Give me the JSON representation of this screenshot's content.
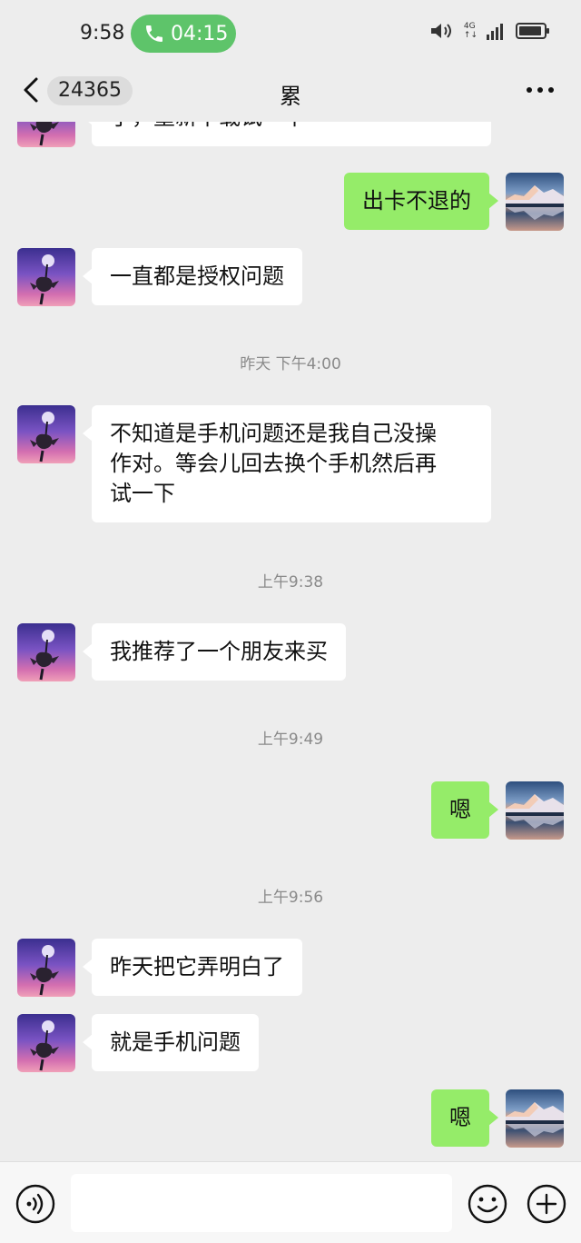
{
  "status_bar": {
    "time": "9:58",
    "call_duration": "04:15",
    "network_label_top": "4G",
    "network_label_bottom": "↑↓"
  },
  "header": {
    "unread_count": "24365",
    "title": "累"
  },
  "messages": [
    {
      "side": "left",
      "text": "了，重新下载试一下",
      "partial": true
    },
    {
      "side": "right",
      "text": "出卡不退的"
    },
    {
      "side": "left",
      "text": "一直都是授权问题"
    },
    {
      "type": "time",
      "text": "昨天 下午4:00"
    },
    {
      "side": "left",
      "lines": [
        "不知道是手机问题还是我自己没操",
        "作对。等会儿回去换个手机然后再",
        "试一下"
      ]
    },
    {
      "type": "time",
      "text": "上午9:38"
    },
    {
      "side": "left",
      "text": "我推荐了一个朋友来买"
    },
    {
      "type": "time",
      "text": "上午9:49"
    },
    {
      "side": "right",
      "text": "嗯"
    },
    {
      "type": "time",
      "text": "上午9:56"
    },
    {
      "side": "left",
      "text": "昨天把它弄明白了"
    },
    {
      "side": "left",
      "text": "就是手机问题"
    },
    {
      "side": "right",
      "text": "嗯"
    }
  ],
  "input": {
    "value": "",
    "placeholder": ""
  },
  "colors": {
    "background": "#ededed",
    "sent_bubble": "#95ec69",
    "received_bubble": "#ffffff",
    "call_pill": "#5ec46a"
  }
}
